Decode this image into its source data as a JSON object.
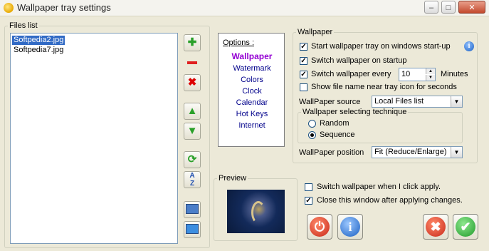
{
  "window": {
    "title": "Wallpaper tray settings"
  },
  "files": {
    "legend": "Files list",
    "items": [
      {
        "name": "Softpedia2.jpg",
        "selected": true
      },
      {
        "name": "Softpedia7.jpg",
        "selected": false
      }
    ]
  },
  "toolbar_icons": [
    "plus-icon",
    "minus-icon",
    "delete-icon",
    "arrow-up-icon",
    "arrow-down-icon",
    "refresh-icon",
    "sort-az-icon",
    "monitor-icon",
    "wallpaper-icon"
  ],
  "options": {
    "header": "Options :",
    "items": [
      "Wallpaper",
      "Watermark",
      "Colors",
      "Clock",
      "Calendar",
      "Hot Keys",
      "Internet"
    ],
    "active": "Wallpaper"
  },
  "wallpaper": {
    "legend": "Wallpaper",
    "start_tray": {
      "label": "Start wallpaper tray on windows start-up",
      "checked": true
    },
    "switch_startup": {
      "label": "Switch wallpaper on startup",
      "checked": true
    },
    "switch_every": {
      "label": "Switch wallpaper every",
      "checked": true,
      "value": "10",
      "unit": "Minutes"
    },
    "show_name": {
      "label": "Show file name near tray icon for seconds",
      "checked": false
    },
    "source": {
      "label": "WallPaper source",
      "value": "Local Files list"
    },
    "technique": {
      "legend": "Wallpaper selecting technique",
      "random": "Random",
      "sequence": "Sequence",
      "selected": "Sequence"
    },
    "position": {
      "label": "WallPaper position",
      "value": "Fit (Reduce/Enlarge)"
    }
  },
  "preview": {
    "legend": "Preview"
  },
  "bottom": {
    "switch_click": {
      "label": "Switch wallpaper when I click apply.",
      "checked": false
    },
    "close_after": {
      "label": "Close this window after applying changes.",
      "checked": true
    }
  },
  "colors": {
    "selection": "#316ac5",
    "option_link": "#00008b",
    "option_active": "#9400d3"
  }
}
